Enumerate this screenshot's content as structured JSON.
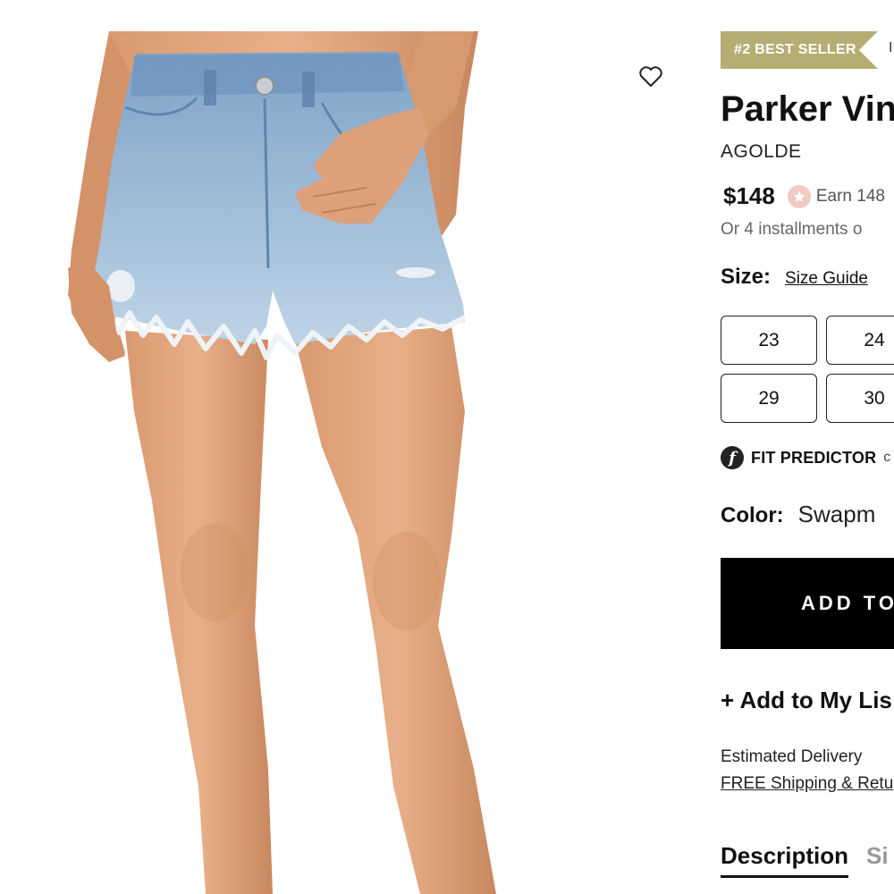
{
  "product": {
    "badge": "#2 BEST SELLER",
    "badge_extra": "I",
    "title": "Parker Vin",
    "brand": "AGOLDE",
    "price": "$148",
    "points_text": "Earn 148",
    "installments": "Or 4 installments o",
    "image_alt": "model wearing light-wash denim cutoff shorts"
  },
  "size": {
    "label": "Size:",
    "guide_label": "Size Guide",
    "options": [
      "23",
      "24",
      "29",
      "30"
    ]
  },
  "fit_predictor": {
    "label": "FIT PREDICTOR",
    "extra": "c"
  },
  "color": {
    "label": "Color:",
    "value": "Swapm"
  },
  "actions": {
    "add_to_bag": "ADD TO",
    "add_to_list": "+ Add to My Lis"
  },
  "shipping": {
    "delivery": "Estimated Delivery",
    "free_shipping": "FREE Shipping & Retu"
  },
  "tabs": [
    "Description",
    "Si"
  ],
  "colors": {
    "badge": "#b6ad74",
    "button": "#000000",
    "points_icon": "#f3c9c3"
  },
  "icons": {
    "wishlist": "heart-outline-icon",
    "points": "star-icon",
    "fit_predictor": "fit-predictor-logo-icon"
  }
}
